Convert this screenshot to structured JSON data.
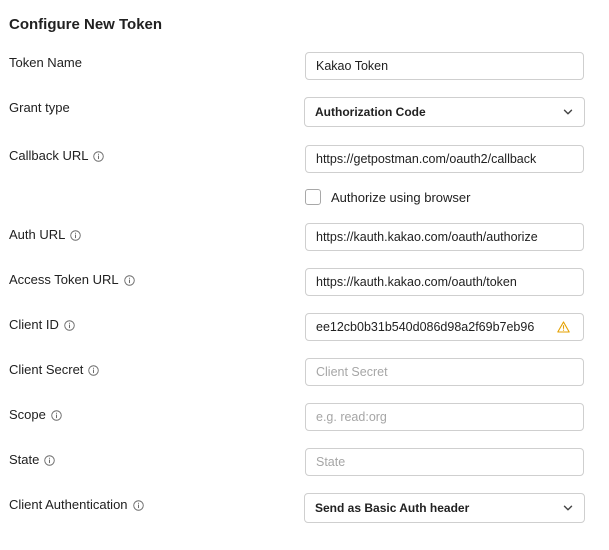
{
  "title": "Configure New Token",
  "fields": {
    "token_name": {
      "label": "Token Name",
      "value": "Kakao Token"
    },
    "grant_type": {
      "label": "Grant type",
      "value": "Authorization Code"
    },
    "callback_url": {
      "label": "Callback URL",
      "value": "https://getpostman.com/oauth2/callback"
    },
    "authorize_browser": {
      "label": "Authorize using browser",
      "checked": false
    },
    "auth_url": {
      "label": "Auth URL",
      "value": "https://kauth.kakao.com/oauth/authorize"
    },
    "access_token_url": {
      "label": "Access Token URL",
      "value": "https://kauth.kakao.com/oauth/token"
    },
    "client_id": {
      "label": "Client ID",
      "value": "ee12cb0b31b540d086d98a2f69b7eb96"
    },
    "client_secret": {
      "label": "Client Secret",
      "value": "",
      "placeholder": "Client Secret"
    },
    "scope": {
      "label": "Scope",
      "value": "",
      "placeholder": "e.g. read:org"
    },
    "state": {
      "label": "State",
      "value": "",
      "placeholder": "State"
    },
    "client_authentication": {
      "label": "Client Authentication",
      "value": "Send as Basic Auth header"
    }
  },
  "colors": {
    "text": "#212121",
    "border": "#cfcfcf",
    "placeholder": "#a6a6a6",
    "warning": "#e5a100"
  },
  "icons": {
    "info": "info-circle-icon",
    "dropdown": "chevron-down-icon",
    "warning": "warning-triangle-icon"
  }
}
